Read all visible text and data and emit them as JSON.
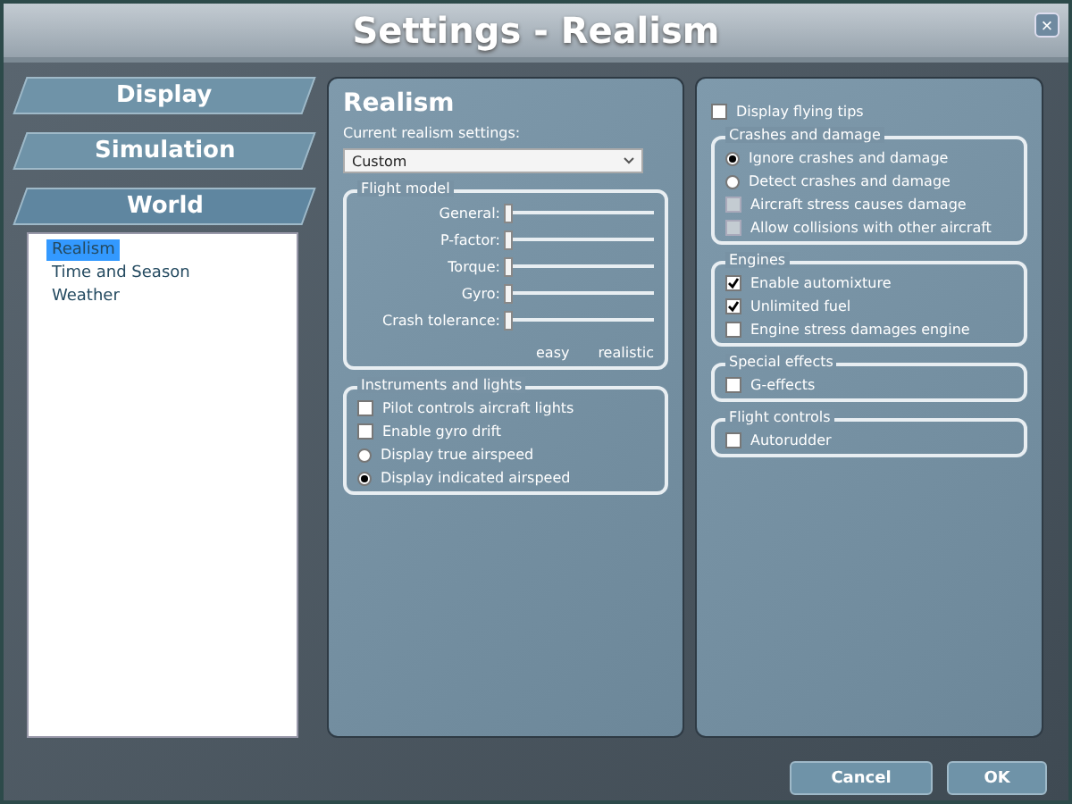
{
  "window": {
    "title": "Settings - Realism",
    "close": "×"
  },
  "categories": [
    {
      "label": "Display",
      "selected": false
    },
    {
      "label": "Simulation",
      "selected": false
    },
    {
      "label": "World",
      "selected": true
    }
  ],
  "subitems": [
    {
      "label": "Realism",
      "selected": true
    },
    {
      "label": "Time and Season",
      "selected": false
    },
    {
      "label": "Weather",
      "selected": false
    }
  ],
  "realism": {
    "heading": "Realism",
    "preset_label": "Current realism settings:",
    "preset_value": "Custom",
    "flight_model": {
      "title": "Flight model",
      "sliders": [
        {
          "label": "General:",
          "level": 0
        },
        {
          "label": "P-factor:",
          "level": 0
        },
        {
          "label": "Torque:",
          "level": 0
        },
        {
          "label": "Gyro:",
          "level": 0
        },
        {
          "label": "Crash tolerance:",
          "level": 0
        }
      ],
      "min_label": "easy",
      "max_label": "realistic"
    },
    "instruments": {
      "title": "Instruments and lights",
      "items": [
        {
          "kind": "checkbox",
          "label": "Pilot controls aircraft lights",
          "checked": false
        },
        {
          "kind": "checkbox",
          "label": "Enable gyro drift",
          "checked": false
        },
        {
          "kind": "radio",
          "label": "Display true airspeed",
          "selected": false
        },
        {
          "kind": "radio",
          "label": "Display indicated airspeed",
          "selected": true
        }
      ]
    }
  },
  "options": {
    "flying_tips": {
      "label": "Display flying tips",
      "checked": false
    },
    "groups": [
      {
        "title": "Crashes and damage",
        "items": [
          {
            "kind": "radio",
            "label": "Ignore crashes and damage",
            "selected": true
          },
          {
            "kind": "radio",
            "label": "Detect crashes and damage",
            "selected": false
          },
          {
            "kind": "checkbox",
            "label": "Aircraft stress causes damage",
            "checked": false,
            "disabled": true
          },
          {
            "kind": "checkbox",
            "label": "Allow collisions with other aircraft",
            "checked": false,
            "disabled": true
          }
        ]
      },
      {
        "title": "Engines",
        "items": [
          {
            "kind": "checkbox",
            "label": "Enable automixture",
            "checked": true,
            "disabled": false
          },
          {
            "kind": "checkbox",
            "label": "Unlimited fuel",
            "checked": true,
            "disabled": false
          },
          {
            "kind": "checkbox",
            "label": "Engine stress damages engine",
            "checked": false,
            "disabled": false
          }
        ]
      },
      {
        "title": "Special effects",
        "items": [
          {
            "kind": "checkbox",
            "label": "G-effects",
            "checked": false,
            "disabled": false
          }
        ]
      },
      {
        "title": "Flight controls",
        "items": [
          {
            "kind": "checkbox",
            "label": "Autorudder",
            "checked": false,
            "disabled": false
          }
        ]
      }
    ]
  },
  "buttons": [
    {
      "label": "Cancel"
    },
    {
      "label": "OK"
    }
  ]
}
